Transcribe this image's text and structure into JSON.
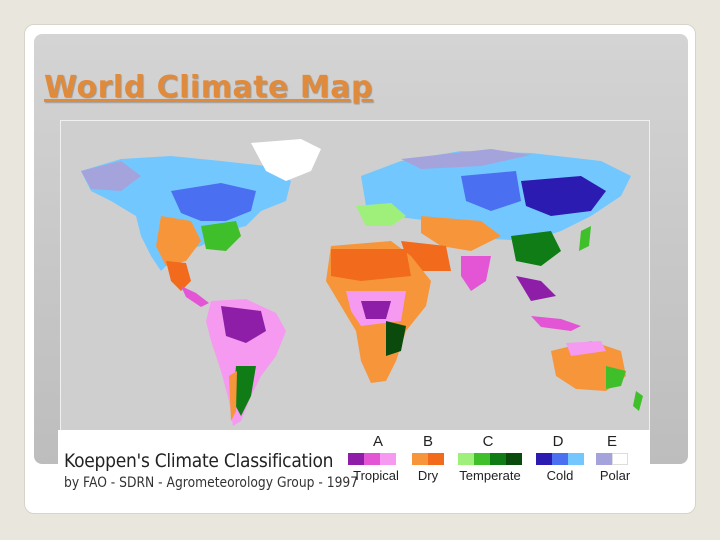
{
  "slide": {
    "title": "World Climate Map"
  },
  "legend": {
    "title": "Koeppen's Climate Classification",
    "subtitle": "by FAO - SDRN - Agrometeorology Group - 1997",
    "classes": [
      {
        "letter": "A",
        "name": "Tropical",
        "colors": [
          "#8e1ea8",
          "#e455d6",
          "#f59af0"
        ]
      },
      {
        "letter": "B",
        "name": "Dry",
        "colors": [
          "#f7953b",
          "#f26a1c"
        ]
      },
      {
        "letter": "C",
        "name": "Temperate",
        "colors": [
          "#9ef07a",
          "#3fbf2a",
          "#0f7c15",
          "#0a4a0c"
        ]
      },
      {
        "letter": "D",
        "name": "Cold",
        "colors": [
          "#2c1bb0",
          "#4a6ff0",
          "#73c7ff"
        ]
      },
      {
        "letter": "E",
        "name": "Polar",
        "colors": [
          "#a5a3dc",
          "#ffffff"
        ]
      }
    ]
  },
  "map": {
    "background": "#cfcfcf"
  }
}
